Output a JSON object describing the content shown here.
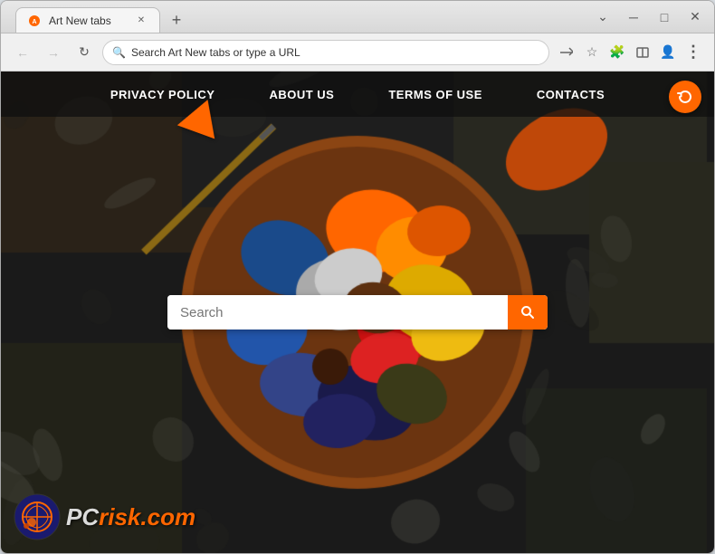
{
  "browser": {
    "tab_title": "Art New tabs",
    "new_tab_icon": "+",
    "url_placeholder": "Search Art New tabs or type a URL",
    "url_text": "Search Art New tabs or type a URL"
  },
  "nav": {
    "items": [
      {
        "label": "PRIVACY POLICY",
        "id": "privacy-policy"
      },
      {
        "label": "ABOUT US",
        "id": "about-us"
      },
      {
        "label": "TERMS OF USE",
        "id": "terms-of-use"
      },
      {
        "label": "CONTACTS",
        "id": "contacts"
      }
    ]
  },
  "search": {
    "placeholder": "Search",
    "button_title": "Search"
  },
  "watermark": {
    "pc": "PC",
    "risk": "risk.com"
  },
  "colors": {
    "orange": "#ff6600",
    "dark_nav": "rgba(15,15,15,0.75)",
    "white": "#ffffff"
  }
}
